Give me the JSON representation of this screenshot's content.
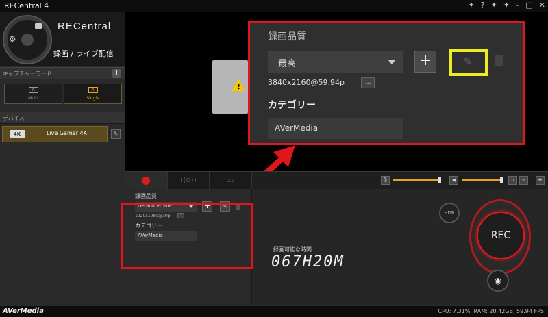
{
  "window": {
    "title": "RECentral 4",
    "controls": [
      "✦",
      "?",
      "✦",
      "✦",
      "–",
      "□",
      "✕"
    ]
  },
  "sidebar": {
    "brand": "RECentral",
    "mode_label": "録画 / ライブ配信",
    "capture_mode_header": "キャプチャーモード",
    "info_label": "i",
    "capture_modes": [
      {
        "icon_text": "A",
        "label": "Multi"
      },
      {
        "icon_text": "A",
        "label": "Single"
      }
    ],
    "device_header": "デバイス",
    "device": {
      "badge": "4K",
      "name": "Live Gamer 4K"
    }
  },
  "zoom_panel": {
    "title": "録画品質",
    "quality_value": "最高",
    "resolution": "3840x2160@59.94p",
    "more_label": "...",
    "category_label": "カテゴリー",
    "category_value": "AVerMedia"
  },
  "settings": {
    "title": "録画品質",
    "quality_value": "Default Profile",
    "resolution": "1920x1080@30p",
    "category_label": "カテゴリー",
    "category_value": "AVerMedia"
  },
  "tabs": [
    {
      "name": "record",
      "symbol": ""
    },
    {
      "name": "stream",
      "symbol": "((o))"
    },
    {
      "name": "schedule",
      "symbol": "☷"
    }
  ],
  "controls": {
    "hdr_label": "HDR",
    "rec_label": "REC",
    "remaining_label": "録画可能な時間",
    "remaining_value": "067H20M",
    "mic_level": 0.8,
    "volume_level": 0.8
  },
  "statusbar": {
    "logo": "AVerMedia",
    "info": "CPU: 7.31%, RAM: 20.42GB, 59.94 FPS"
  },
  "colors": {
    "accent": "#f0a020",
    "highlight_red": "#e2141c",
    "highlight_yellow": "#ecec22"
  }
}
